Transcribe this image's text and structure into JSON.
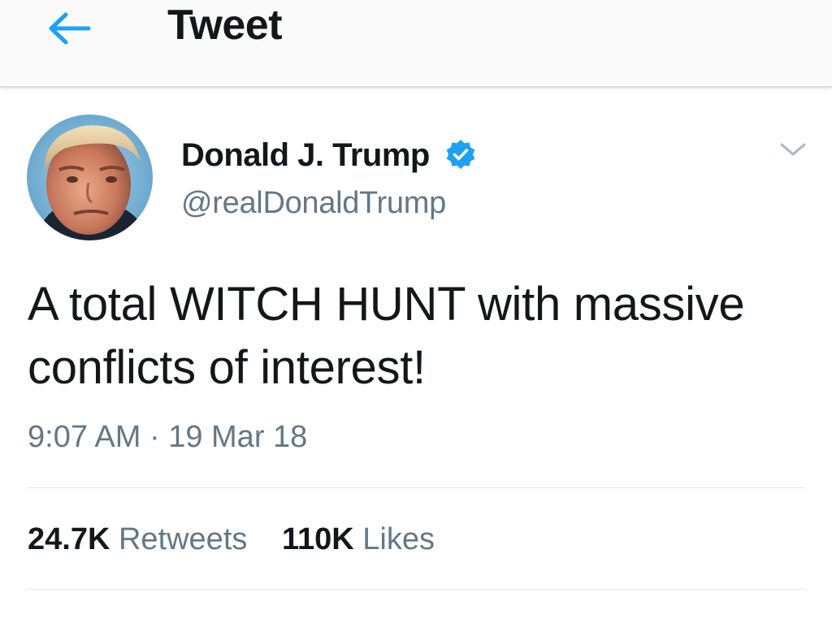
{
  "header": {
    "title": "Tweet",
    "back_icon": "arrow-left-icon",
    "accent_color": "#1da1f2"
  },
  "tweet": {
    "author": {
      "display_name": "Donald J. Trump",
      "handle": "@realDonaldTrump",
      "verified": true,
      "verified_icon": "verified-badge-icon"
    },
    "text": "A total WITCH HUNT with massive conflicts of interest!",
    "time": "9:07 AM",
    "separator": "·",
    "date": "19 Mar 18",
    "more_icon": "chevron-down-icon"
  },
  "stats": {
    "retweets_count": "24.7K",
    "retweets_label": "Retweets",
    "likes_count": "110K",
    "likes_label": "Likes"
  },
  "colors": {
    "text_primary": "#14171a",
    "text_secondary": "#657786",
    "divider": "#e1e8ed",
    "verified": "#1da1f2"
  }
}
